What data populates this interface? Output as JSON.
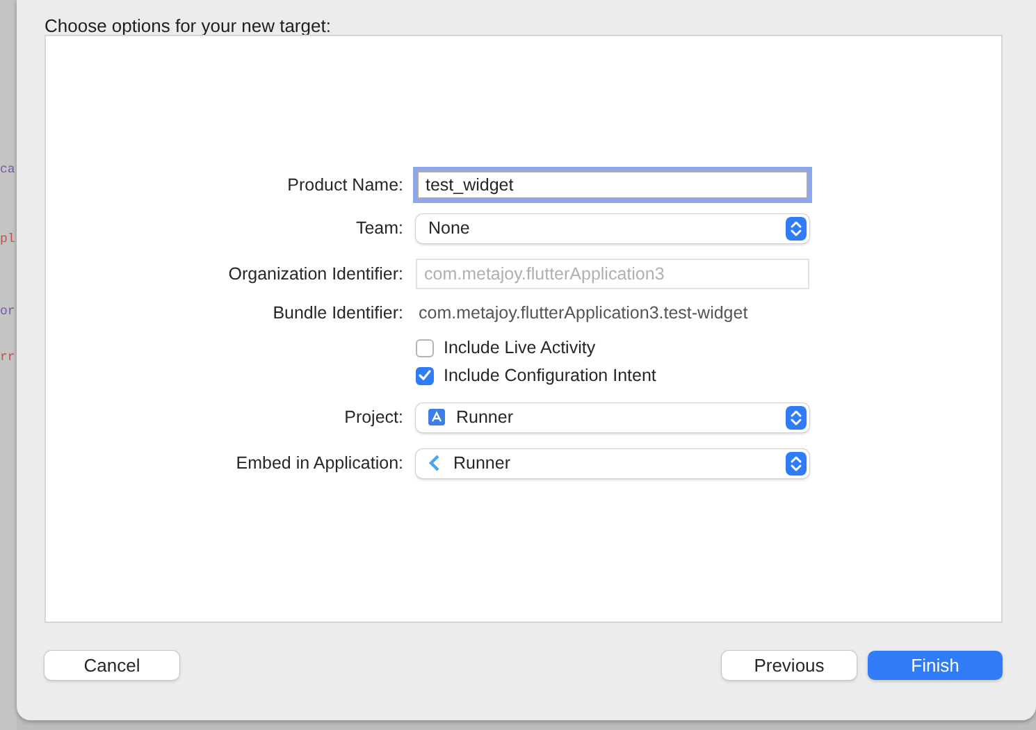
{
  "background": {
    "code_fragments": [
      {
        "text": "ca",
        "color": "#7a5aa8"
      },
      {
        "text": "pl",
        "color": "#c0504d"
      },
      {
        "text": "or",
        "color": "#7a5aa8"
      },
      {
        "text": "rr",
        "color": "#c0504d"
      }
    ]
  },
  "sheet": {
    "title": "Choose options for your new target:"
  },
  "form": {
    "rows": [
      {
        "kind": "text-field",
        "label": "Product Name:",
        "value": "test_widget",
        "focused": true
      },
      {
        "kind": "popup",
        "label": "Team:",
        "value": "None"
      },
      {
        "kind": "text-field",
        "label": "Organization Identifier:",
        "placeholder": "com.metajoy.flutterApplication3",
        "focused": false
      },
      {
        "kind": "static",
        "label": "Bundle Identifier:",
        "value": "com.metajoy.flutterApplication3.test-widget"
      },
      {
        "kind": "checkbox",
        "label": "Include Live Activity",
        "checked": false
      },
      {
        "kind": "checkbox",
        "label": "Include Configuration Intent",
        "checked": true
      },
      {
        "kind": "project",
        "label": "Project:",
        "value": "Runner"
      },
      {
        "kind": "application",
        "label": "Embed in Application:",
        "value": "Runner"
      }
    ]
  },
  "buttons": [
    {
      "label": "Cancel",
      "kind": "plain"
    },
    {
      "label": "Previous",
      "kind": "plain"
    },
    {
      "label": "Finish",
      "kind": "primary"
    }
  ]
}
